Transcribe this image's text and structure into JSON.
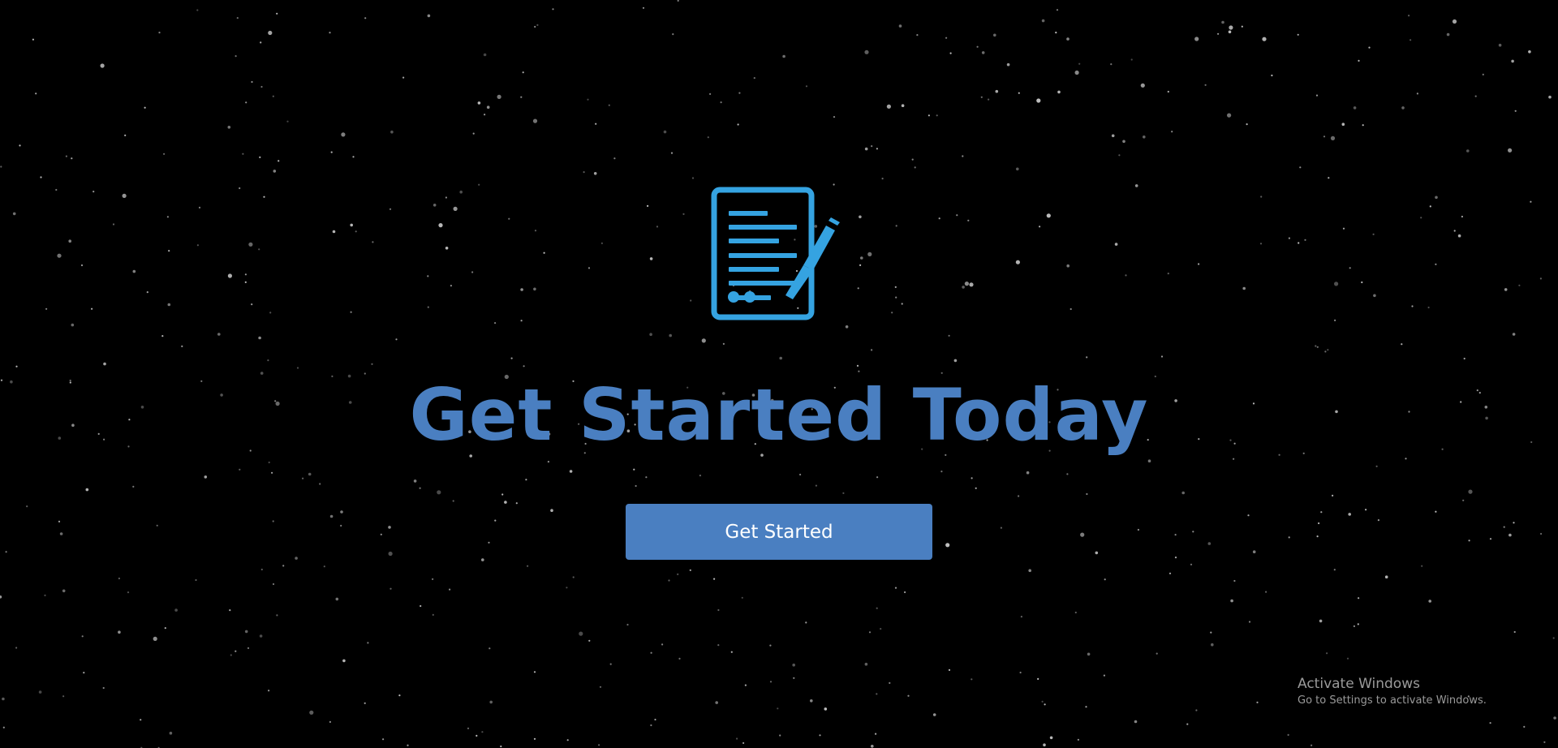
{
  "hero": {
    "icon": "document-with-pencil-icon",
    "title": "Get Started Today",
    "button_label": "Get Started"
  },
  "watermark": {
    "title": "Activate Windows",
    "subtitle": "Go to Settings to activate Windows."
  },
  "colors": {
    "background": "#000000",
    "icon": "#35a3e1",
    "title": "#4a7fc1",
    "button_bg": "#4a7fc1",
    "button_text": "#ffffff",
    "watermark_text": "#9a9a9a",
    "stars": "#c8c8c8"
  }
}
